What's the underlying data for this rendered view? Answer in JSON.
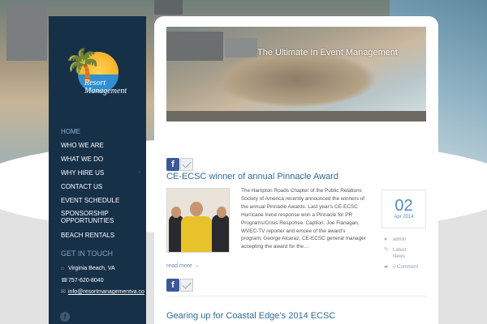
{
  "site": {
    "logo_text_line1": "Resort",
    "logo_text_line2": "Management"
  },
  "nav": {
    "items": [
      {
        "label": "HOME",
        "active": true
      },
      {
        "label": "WHO WE ARE"
      },
      {
        "label": "WHAT WE DO"
      },
      {
        "label": "WHY HIRE US",
        "has_submenu": true
      },
      {
        "label": "CONTACT US"
      },
      {
        "label": "EVENT SCHEDULE"
      },
      {
        "label": "SPONSORSHIP OPPORTUNITIES"
      },
      {
        "label": "BEACH RENTALS"
      }
    ],
    "submenu_arrow": "›"
  },
  "contact": {
    "heading": "GET IN TOUCH",
    "location": "Virginia Beach, VA",
    "phone": "757-620-8040",
    "email": "info@resortmanagementva.co"
  },
  "hero": {
    "title": "The Ultimate In Event Management"
  },
  "share": {
    "facebook_glyph": "f"
  },
  "posts": [
    {
      "title": "CE-ECSC winner of annual Pinnacle Award",
      "excerpt": "The Hampton Roads Chapter of the Public Relations Society of America recently announced the winners of the annual Pinnacle Awards. Last year’s CE-ECSC Hurricane Irene response won a Pinnacle for PR Programs/Crisis Response. Caption: Joe Flanagan, WVEC-TV reporter and emcee of the award’s program; George Alcaraz, CE-ECSC general manager accepting the award for the…",
      "read_more": "read more →",
      "date_day": "02",
      "date_month": "Apr 2014",
      "author": "admin",
      "category": "Latest News",
      "comments": "0 Comment"
    },
    {
      "title": "Gearing up for Coastal Edge’s 2014 ECSC"
    }
  ],
  "colors": {
    "sidebar": "#163048",
    "link": "#2f6d97",
    "date_accent": "#4f8dc0"
  }
}
